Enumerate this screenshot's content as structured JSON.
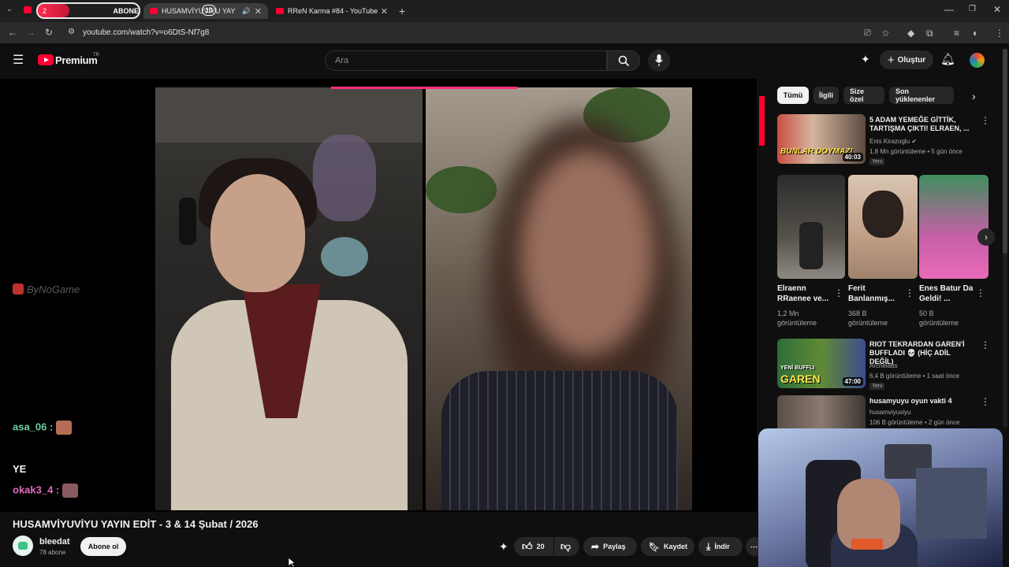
{
  "browser": {
    "tabs": [
      {
        "title": "2",
        "badge": "ABONE",
        "active": false
      },
      {
        "title": "HUSAMVİYUVİYU YAYIN EDİ",
        "counter": "10",
        "active": true
      },
      {
        "title": "RReN Karma #84 - YouTube",
        "active": false
      }
    ],
    "url": "youtube.com/watch?v=o6DtS-Nf7g8"
  },
  "header": {
    "logo_text": "Premium",
    "region": "TR",
    "search_placeholder": "Ara",
    "create_label": "Oluştur"
  },
  "video": {
    "title": "HUSAMVİYUVİYU YAYIN EDİT - 3 & 14 Şubat / 2026",
    "watermark": "ByNoGame",
    "chat": [
      {
        "user": "asa_06 :"
      },
      {
        "user": "YE"
      },
      {
        "user": "okak3_4 :"
      }
    ]
  },
  "channel": {
    "name": "bleedat",
    "subscribers": "78 abone",
    "subscribe_label": "Abone ol"
  },
  "actions": {
    "likes": "20",
    "share": "Paylaş",
    "save": "Kaydet",
    "download": "İndir"
  },
  "sidebar": {
    "chips": [
      "Tümü",
      "İlgili",
      "Size özel",
      "Son yüklenenler"
    ],
    "videos": [
      {
        "title": "5 ADAM YEMEĞE GİTTİK, TARTIŞMA ÇIKTI! ELRAEN, ...",
        "channel": "Enis Kirazoglu",
        "meta": "1,8 Mn görüntüleme • 5 gün önce",
        "badge": "Yeni",
        "duration": "40:03",
        "thumb_text": "BUNLAR DOYMAZ!"
      },
      {
        "title": "RIOT TEKRARDAN GAREN'İ BUFFLADI 💀 (HİÇ ADİL DEĞİL)",
        "channel": "Archelaus",
        "meta": "6,4 B görüntüleme • 1 saat önce",
        "badge": "Yeni",
        "duration": "47:00",
        "thumb_text": "GAREN",
        "thumb_text_small": "YENİ BUFFLI"
      },
      {
        "title": "husamyuyu oyun vakti 4",
        "channel": "husamviyuviyu",
        "meta": "106 B görüntüleme • 2 gün önce"
      }
    ],
    "shorts": [
      {
        "title": "Elraenn RRaenee ve...",
        "views": "1,2 Mn",
        "views_label": "görüntüleme"
      },
      {
        "title": "Ferit Banlanmış...",
        "views": "368 B",
        "views_label": "görüntüleme"
      },
      {
        "title": "Enes Batur Da Geldi! ...",
        "views": "50 B",
        "views_label": "görüntüleme"
      }
    ]
  },
  "colors": {
    "brand_red": "#ff0033",
    "chat_green": "#6dd19c",
    "bg": "#0f0f0f"
  }
}
